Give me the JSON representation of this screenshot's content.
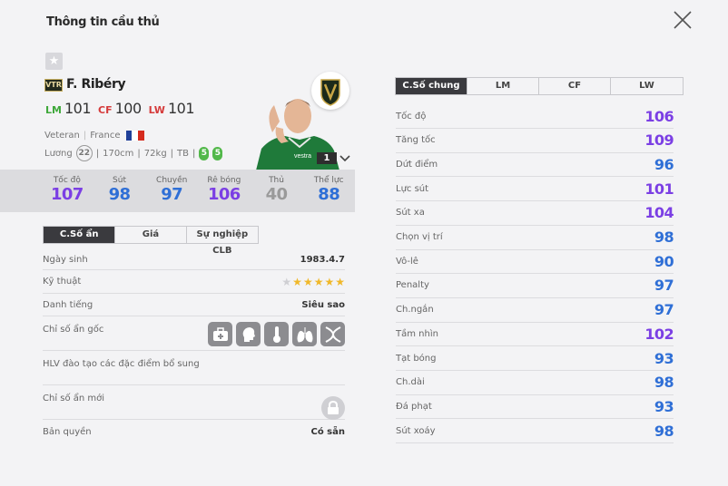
{
  "title": "Thông tin cầu thủ",
  "player": {
    "season": "VTR",
    "name": "F. Ribéry",
    "positions": [
      {
        "label": "LM",
        "value": "101",
        "color": "#3ea83a"
      },
      {
        "label": "CF",
        "value": "100",
        "color": "#d53a3a"
      },
      {
        "label": "LW",
        "value": "101",
        "color": "#d53a3a"
      }
    ],
    "season_name": "Veteran",
    "nation": "France",
    "salary_label": "Lương",
    "salary": "22",
    "height": "170cm",
    "weight": "72kg",
    "body": "TB",
    "weak_foot": "5",
    "skill": "5",
    "level": "1"
  },
  "main_stats": [
    {
      "label": "Tốc độ",
      "value": "107",
      "color": "#7b3fe4"
    },
    {
      "label": "Sút",
      "value": "98",
      "color": "#2f6fd6"
    },
    {
      "label": "Chuyền",
      "value": "97",
      "color": "#2f6fd6"
    },
    {
      "label": "Rê bóng",
      "value": "106",
      "color": "#7b3fe4"
    },
    {
      "label": "Thủ",
      "value": "40",
      "color": "#9a9a9a"
    },
    {
      "label": "Thể lực",
      "value": "88",
      "color": "#2f6fd6"
    }
  ],
  "left_tabs": [
    "C.Số ẩn",
    "Giá",
    "Sự nghiệp CLB"
  ],
  "info": {
    "birth_label": "Ngày sinh",
    "birth": "1983.4.7",
    "skill_label": "Kỹ thuật",
    "skill_stars": 5,
    "fame_label": "Danh tiếng",
    "fame": "Siêu sao",
    "traits_label": "Chỉ số ẩn gốc",
    "coach_label": "HLV đào tạo các đặc điểm bổ sung",
    "new_traits_label": "Chỉ số ẩn mới",
    "license_label": "Bản quyền",
    "license": "Có sẵn"
  },
  "right_tabs": [
    "C.Số chung",
    "LM",
    "CF",
    "LW"
  ],
  "attributes": [
    {
      "label": "Tốc độ",
      "value": "106",
      "color": "#7b3fe4"
    },
    {
      "label": "Tăng tốc",
      "value": "109",
      "color": "#7b3fe4"
    },
    {
      "label": "Dứt điểm",
      "value": "96",
      "color": "#2f6fd6"
    },
    {
      "label": "Lực sút",
      "value": "101",
      "color": "#7b3fe4"
    },
    {
      "label": "Sút xa",
      "value": "104",
      "color": "#7b3fe4"
    },
    {
      "label": "Chọn vị trí",
      "value": "98",
      "color": "#2f6fd6"
    },
    {
      "label": "Vô-lê",
      "value": "90",
      "color": "#2f6fd6"
    },
    {
      "label": "Penalty",
      "value": "97",
      "color": "#2f6fd6"
    },
    {
      "label": "Ch.ngắn",
      "value": "97",
      "color": "#2f6fd6"
    },
    {
      "label": "Tầm nhìn",
      "value": "102",
      "color": "#7b3fe4"
    },
    {
      "label": "Tạt bóng",
      "value": "93",
      "color": "#2f6fd6"
    },
    {
      "label": "Ch.dài",
      "value": "98",
      "color": "#2f6fd6"
    },
    {
      "label": "Đá phạt",
      "value": "93",
      "color": "#2f6fd6"
    },
    {
      "label": "Sút xoáy",
      "value": "98",
      "color": "#2f6fd6"
    }
  ]
}
